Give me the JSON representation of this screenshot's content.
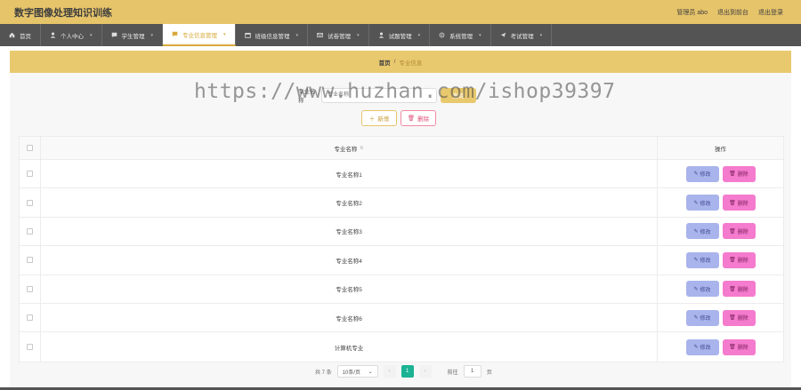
{
  "header": {
    "title": "数字图像处理知识训练",
    "admin": "管理员 abo",
    "back_link": "退出到前台",
    "logout": "退出登录"
  },
  "nav": [
    {
      "label": "首页",
      "icon": "home-icon",
      "active": false
    },
    {
      "label": "个人中心",
      "icon": "user-icon",
      "active": false
    },
    {
      "label": "学生管理",
      "icon": "chat-icon",
      "active": false
    },
    {
      "label": "专业信息管理",
      "icon": "chat-icon",
      "active": true
    },
    {
      "label": "班级信息管理",
      "icon": "calendar-icon",
      "active": false
    },
    {
      "label": "试卷管理",
      "icon": "mail-icon",
      "active": false
    },
    {
      "label": "试题管理",
      "icon": "user-icon",
      "active": false
    },
    {
      "label": "系统管理",
      "icon": "gear-icon",
      "active": false
    },
    {
      "label": "考试管理",
      "icon": "send-icon",
      "active": false
    }
  ],
  "breadcrumb": {
    "home": "首页",
    "separator": "/",
    "current": "专业信息"
  },
  "search": {
    "label": "专业名称",
    "placeholder": "专业名称",
    "button": "查询"
  },
  "actions": {
    "add": "新增",
    "delete": "删除"
  },
  "table": {
    "columns": [
      "专业名称",
      "操作"
    ],
    "rows": [
      "专业名称1",
      "专业名称2",
      "专业名称3",
      "专业名称4",
      "专业名称5",
      "专业名称6",
      "计算机专业"
    ],
    "edit_label": "修改",
    "delete_label": "删除"
  },
  "pagination": {
    "total": "共 7 条",
    "page_size": "10条/页",
    "current_page": "1",
    "goto_label": "前往",
    "goto_value": "1",
    "page_suffix": "页"
  },
  "watermark": "https://www.huzhan.com/ishop39397",
  "colors": {
    "header": "#e6c46a",
    "nav": "#545454",
    "edit": "#a9b4ec",
    "delete": "#f47bcd",
    "page_active": "#1bb394"
  }
}
